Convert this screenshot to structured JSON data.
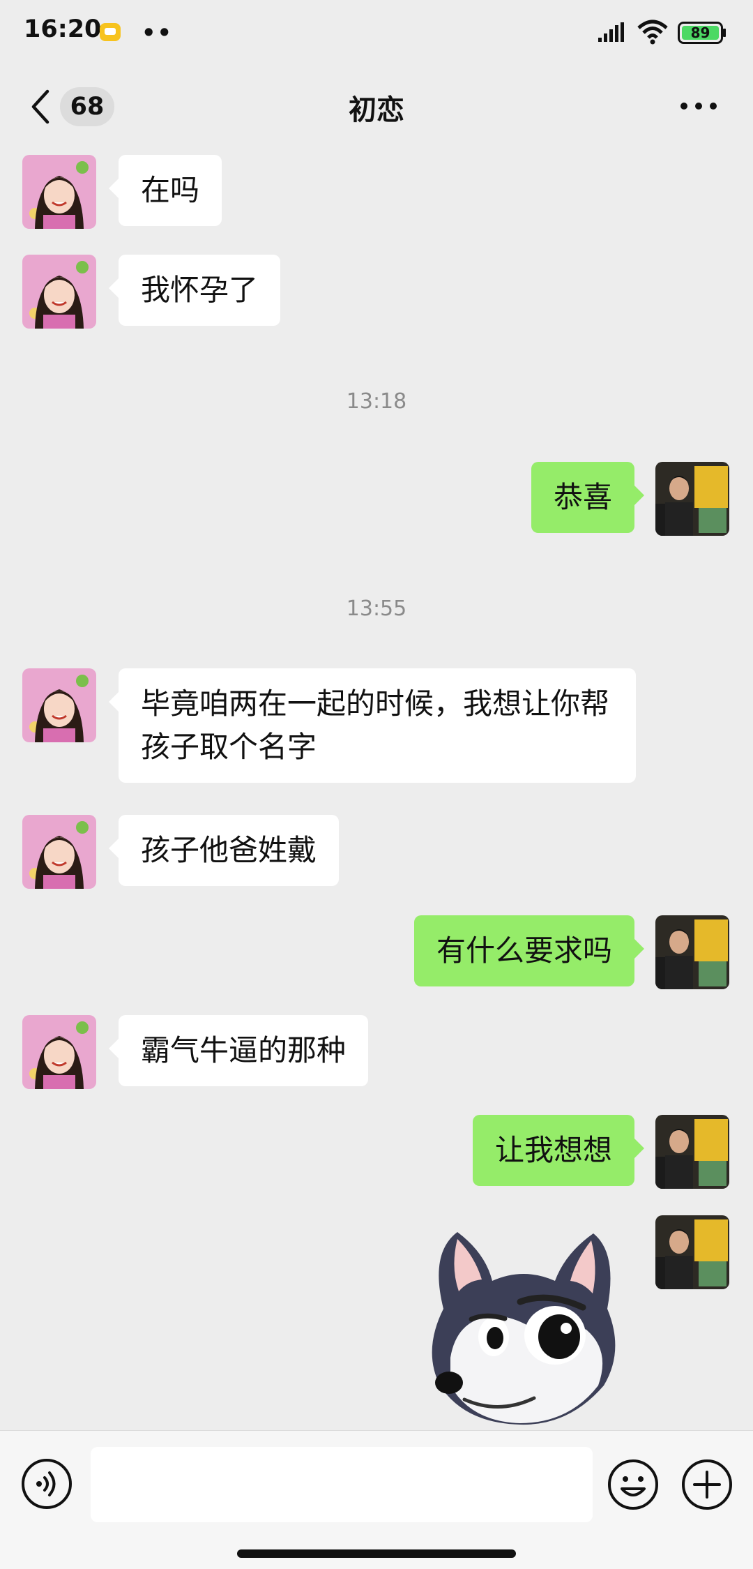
{
  "status_bar": {
    "time": "16:20",
    "battery_level": "89",
    "icons": [
      "message-notification-icon",
      "more-dots",
      "signal-icon",
      "wifi-icon",
      "battery-icon"
    ]
  },
  "header": {
    "unread_count": "68",
    "title": "初恋",
    "icons": [
      "back-chevron-icon",
      "more-icon"
    ]
  },
  "messages": [
    {
      "side": "left",
      "text": "在吗"
    },
    {
      "side": "left",
      "text": "我怀孕了"
    },
    {
      "side": "time",
      "text": "13:18"
    },
    {
      "side": "right",
      "text": "恭喜"
    },
    {
      "side": "time",
      "text": "13:55"
    },
    {
      "side": "left",
      "text": "毕竟咱两在一起的时候，我想让你帮孩子取个名字"
    },
    {
      "side": "left",
      "text": "孩子他爸姓戴"
    },
    {
      "side": "right",
      "text": "有什么要求吗"
    },
    {
      "side": "left",
      "text": "霸气牛逼的那种"
    },
    {
      "side": "right",
      "text": "让我想想"
    },
    {
      "side": "right",
      "type": "sticker",
      "sticker_name": "dog-sticker"
    }
  ],
  "input_bar": {
    "icons": [
      "voice-icon",
      "emoji-icon",
      "plus-icon"
    ],
    "input_value": ""
  },
  "colors": {
    "background": "#ededed",
    "sent_bubble": "#95ec69",
    "received_bubble": "#ffffff",
    "battery_fill": "#4cd964"
  }
}
